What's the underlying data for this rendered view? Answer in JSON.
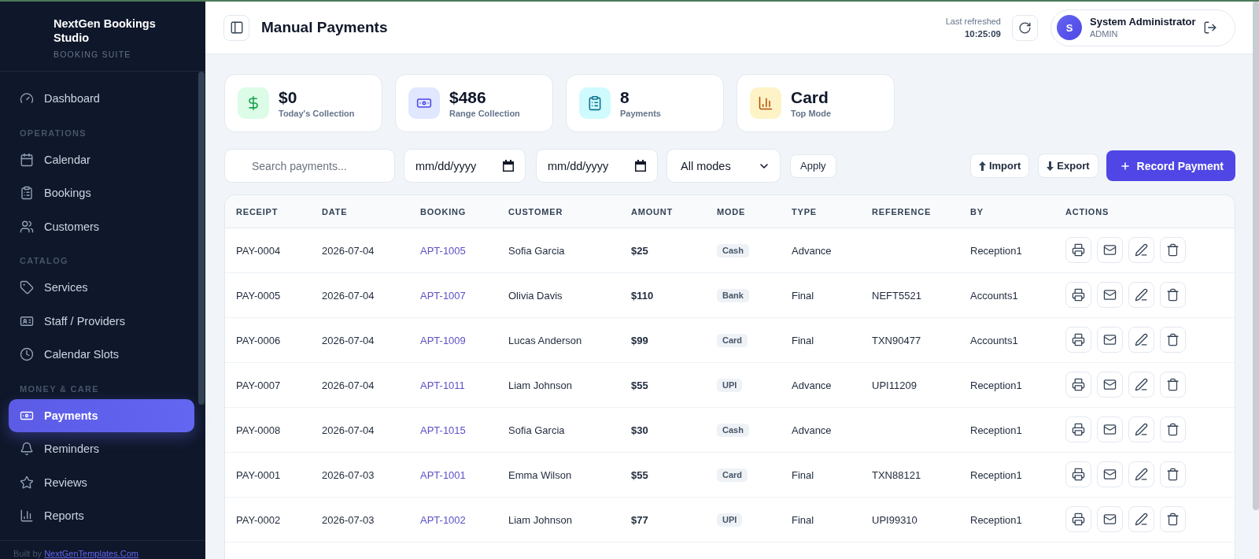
{
  "sidebar": {
    "brand": {
      "name": "NextGen Bookings Studio",
      "tagline": "BOOKING SUITE"
    },
    "sections": [
      {
        "items": [
          {
            "label": "Dashboard",
            "selected": false
          }
        ]
      },
      {
        "title": "OPERATIONS",
        "items": [
          {
            "label": "Calendar",
            "selected": false
          },
          {
            "label": "Bookings",
            "selected": false
          },
          {
            "label": "Customers",
            "selected": false
          }
        ]
      },
      {
        "title": "CATALOG",
        "items": [
          {
            "label": "Services",
            "selected": false
          },
          {
            "label": "Staff / Providers",
            "selected": false
          },
          {
            "label": "Calendar Slots",
            "selected": false
          }
        ]
      },
      {
        "title": "MONEY & CARE",
        "items": [
          {
            "label": "Payments",
            "selected": true
          },
          {
            "label": "Reminders",
            "selected": false
          },
          {
            "label": "Reviews",
            "selected": false
          },
          {
            "label": "Reports",
            "selected": false
          }
        ]
      }
    ],
    "footer": {
      "text": "Built by",
      "link": "NextGenTemplates.Com"
    }
  },
  "header": {
    "title": "Manual Payments",
    "refreshed_label": "Last refreshed",
    "refreshed_time": "10:25:09",
    "user": {
      "initial": "S",
      "name": "System Administrator",
      "role": "ADMIN"
    }
  },
  "stats": [
    {
      "value": "$0",
      "label": "Today's Collection",
      "color": "#dcfce7"
    },
    {
      "value": "$486",
      "label": "Range Collection",
      "color": "#e0e7ff"
    },
    {
      "value": "8",
      "label": "Payments",
      "color": "#cffafe"
    },
    {
      "value": "Card",
      "label": "Top Mode",
      "color": "#fef3c7"
    }
  ],
  "filters": {
    "search": {
      "placeholder": "Search payments..."
    },
    "date_from": {
      "placeholder": "mm/dd/yyyy"
    },
    "date_to": {
      "placeholder": "mm/dd/yyyy"
    },
    "mode": {
      "value": "All modes"
    },
    "apply": "Apply"
  },
  "actions": [
    {
      "kind": "import",
      "label": "Import"
    },
    {
      "kind": "export",
      "label": "Export"
    },
    {
      "kind": "primary",
      "label": "Record Payment"
    }
  ],
  "table": {
    "columns": [
      "RECEIPT",
      "DATE",
      "BOOKING",
      "CUSTOMER",
      "AMOUNT",
      "MODE",
      "TYPE",
      "REFERENCE",
      "BY",
      "ACTIONS"
    ],
    "rows": [
      {
        "receipt": "PAY-0004",
        "date": "2026-07-04",
        "booking": "APT-1005",
        "customer": "Sofia Garcia",
        "amount": "$25",
        "mode": "Cash",
        "type": "Advance",
        "by": "Reception1"
      },
      {
        "receipt": "PAY-0005",
        "date": "2026-07-04",
        "booking": "APT-1007",
        "customer": "Olivia Davis",
        "amount": "$110",
        "mode": "Bank",
        "type": "Final",
        "reference": "NEFT5521",
        "by": "Accounts1"
      },
      {
        "receipt": "PAY-0006",
        "date": "2026-07-04",
        "booking": "APT-1009",
        "customer": "Lucas Anderson",
        "amount": "$99",
        "mode": "Card",
        "type": "Final",
        "reference": "TXN90477",
        "by": "Accounts1"
      },
      {
        "receipt": "PAY-0007",
        "date": "2026-07-04",
        "booking": "APT-1011",
        "customer": "Liam Johnson",
        "amount": "$55",
        "mode": "UPI",
        "type": "Advance",
        "reference": "UPI11209",
        "by": "Reception1"
      },
      {
        "receipt": "PAY-0008",
        "date": "2026-07-04",
        "booking": "APT-1015",
        "customer": "Sofia Garcia",
        "amount": "$30",
        "mode": "Cash",
        "type": "Advance",
        "by": "Reception1"
      },
      {
        "receipt": "PAY-0001",
        "date": "2026-07-03",
        "booking": "APT-1001",
        "customer": "Emma Wilson",
        "amount": "$55",
        "mode": "Card",
        "type": "Final",
        "reference": "TXN88121",
        "by": "Reception1"
      },
      {
        "receipt": "PAY-0002",
        "date": "2026-07-03",
        "booking": "APT-1002",
        "customer": "Liam Johnson",
        "amount": "$77",
        "mode": "UPI",
        "type": "Final",
        "reference": "UPI99310",
        "by": "Reception1"
      }
    ]
  }
}
